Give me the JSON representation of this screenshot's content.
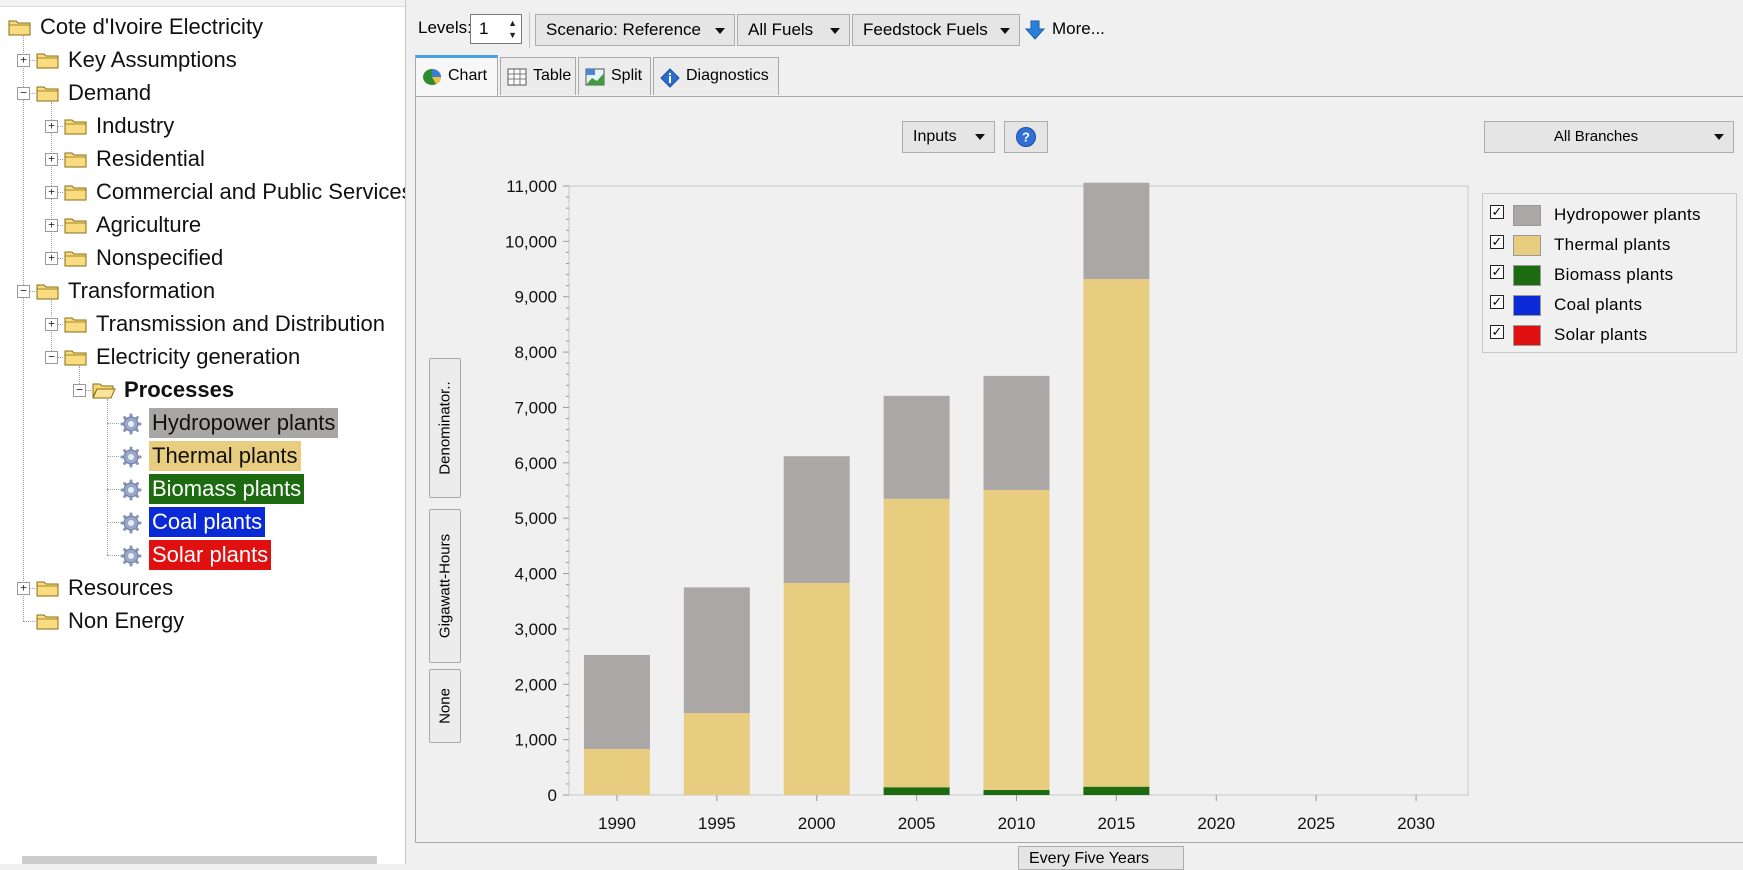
{
  "tree": {
    "nodes": [
      {
        "label": "Cote d'Ivoire Electricity",
        "depth": 0,
        "expander": "",
        "icon": "folder",
        "bold": false,
        "highlight": ""
      },
      {
        "label": "Key Assumptions",
        "depth": 1,
        "expander": "+",
        "icon": "folder",
        "bold": false,
        "highlight": ""
      },
      {
        "label": "Demand",
        "depth": 1,
        "expander": "-",
        "icon": "folder",
        "bold": false,
        "highlight": ""
      },
      {
        "label": "Industry",
        "depth": 2,
        "expander": "+",
        "icon": "folder",
        "bold": false,
        "highlight": ""
      },
      {
        "label": "Residential",
        "depth": 2,
        "expander": "+",
        "icon": "folder",
        "bold": false,
        "highlight": ""
      },
      {
        "label": "Commercial and Public Services",
        "depth": 2,
        "expander": "+",
        "icon": "folder",
        "bold": false,
        "highlight": ""
      },
      {
        "label": "Agriculture",
        "depth": 2,
        "expander": "+",
        "icon": "folder",
        "bold": false,
        "highlight": ""
      },
      {
        "label": "Nonspecified",
        "depth": 2,
        "expander": "+",
        "icon": "folder",
        "bold": false,
        "highlight": ""
      },
      {
        "label": "Transformation",
        "depth": 1,
        "expander": "-",
        "icon": "folder",
        "bold": false,
        "highlight": ""
      },
      {
        "label": "Transmission and Distribution",
        "depth": 2,
        "expander": "+",
        "icon": "folder",
        "bold": false,
        "highlight": ""
      },
      {
        "label": "Electricity generation",
        "depth": 2,
        "expander": "-",
        "icon": "folder",
        "bold": false,
        "highlight": ""
      },
      {
        "label": "Processes",
        "depth": 3,
        "expander": "-",
        "icon": "folder-open",
        "bold": true,
        "highlight": ""
      },
      {
        "label": "Hydropower plants",
        "depth": 4,
        "expander": "",
        "icon": "gear",
        "bold": false,
        "highlight": "#a9a6a6"
      },
      {
        "label": "Thermal plants",
        "depth": 4,
        "expander": "",
        "icon": "gear",
        "bold": false,
        "highlight": "#e8cd80"
      },
      {
        "label": "Biomass plants",
        "depth": 4,
        "expander": "",
        "icon": "gear",
        "bold": false,
        "highlight": "#1d6b10"
      },
      {
        "label": "Coal plants",
        "depth": 4,
        "expander": "",
        "icon": "gear",
        "bold": false,
        "highlight": "#0a2ad8"
      },
      {
        "label": "Solar plants",
        "depth": 4,
        "expander": "",
        "icon": "gear",
        "bold": false,
        "highlight": "#e01010"
      },
      {
        "label": "Resources",
        "depth": 1,
        "expander": "+",
        "icon": "folder",
        "bold": false,
        "highlight": ""
      },
      {
        "label": "Non Energy",
        "depth": 1,
        "expander": "",
        "icon": "folder",
        "bold": false,
        "highlight": ""
      }
    ]
  },
  "toolbar": {
    "levels_label": "Levels:",
    "levels_value": "1",
    "scenario": "Scenario: Reference",
    "fuels": "All Fuels",
    "feedstock": "Feedstock Fuels",
    "more": "More..."
  },
  "tabs": [
    {
      "label": "Chart",
      "icon": "chart-icon",
      "active": true
    },
    {
      "label": "Table",
      "icon": "table-icon",
      "active": false
    },
    {
      "label": "Split",
      "icon": "split-icon",
      "active": false
    },
    {
      "label": "Diagnostics",
      "icon": "diagnostics-icon",
      "active": false
    }
  ],
  "panel": {
    "inputs_label": "Inputs",
    "help_icon": "help-icon",
    "branches_label": "All Branches",
    "denominator_label": "Denominator..",
    "unit_label": "Gigawatt-Hours",
    "none_label": "None",
    "every_label": "Every Five Years"
  },
  "colors": {
    "hydro": "#aba7a7",
    "thermal": "#e8cd80",
    "biomass": "#1d6b10",
    "coal": "#0a2ad8",
    "solar": "#e01010"
  },
  "chart_data": {
    "type": "bar",
    "stacked": true,
    "title": "",
    "xlabel": "",
    "ylabel": "Gigawatt-Hours",
    "categories": [
      "1990",
      "1995",
      "2000",
      "2005",
      "2010",
      "2015",
      "2020",
      "2025",
      "2030"
    ],
    "ylim": [
      0,
      11000
    ],
    "yticks": [
      "0",
      "1,000",
      "2,000",
      "3,000",
      "4,000",
      "5,000",
      "6,000",
      "7,000",
      "8,000",
      "9,000",
      "10,000",
      "11,000"
    ],
    "grid": false,
    "legend_position": "right",
    "series": [
      {
        "name": "Hydropower plants",
        "color": "#aba7a7",
        "checked": true,
        "values": [
          1700,
          2270,
          2290,
          1860,
          2060,
          1740,
          null,
          null,
          null
        ]
      },
      {
        "name": "Thermal plants",
        "color": "#e8cd80",
        "checked": true,
        "values": [
          830,
          1480,
          3830,
          5210,
          5420,
          9170,
          null,
          null,
          null
        ]
      },
      {
        "name": "Biomass plants",
        "color": "#1d6b10",
        "checked": true,
        "values": [
          0,
          0,
          0,
          140,
          90,
          150,
          null,
          null,
          null
        ]
      },
      {
        "name": "Coal plants",
        "color": "#0a2ad8",
        "checked": true,
        "values": [
          0,
          0,
          0,
          0,
          0,
          0,
          null,
          null,
          null
        ]
      },
      {
        "name": "Solar plants",
        "color": "#e01010",
        "checked": true,
        "values": [
          0,
          0,
          0,
          0,
          0,
          0,
          null,
          null,
          null
        ]
      }
    ]
  }
}
